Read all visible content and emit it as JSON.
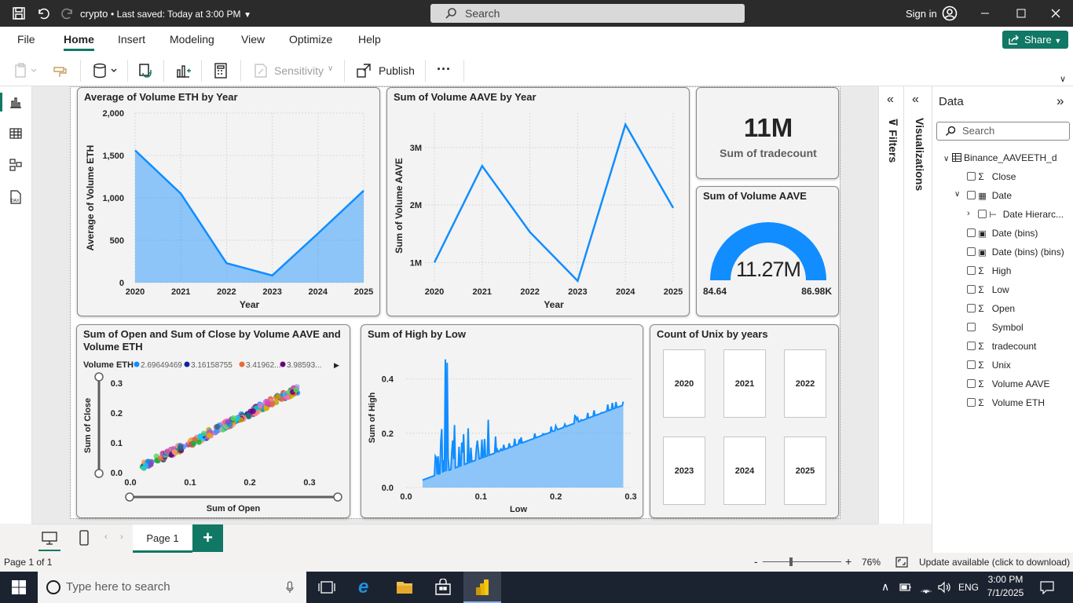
{
  "titlebar": {
    "doc": "crypto",
    "saved": "• Last saved: Today at 3:00 PM",
    "search": "Search",
    "signin": "Sign in"
  },
  "menu": [
    "File",
    "Home",
    "Insert",
    "Modeling",
    "View",
    "Optimize",
    "Help"
  ],
  "share": "Share",
  "ribbon": {
    "sensitivity": "Sensitivity",
    "publish": "Publish",
    "more": "···"
  },
  "visuals": {
    "ethTitle": "Average of Volume ETH by Year",
    "ethY": "Average of Volume ETH",
    "ethX": "Year",
    "aaveTitle": "Sum of Volume AAVE by Year",
    "aaveY": "Sum of Volume AAVE",
    "aaveX": "Year",
    "cardValue": "11M",
    "cardLabel": "Sum of tradecount",
    "gaugeTitle": "Sum of Volume AAVE",
    "gaugeValue": "11.27M",
    "gaugeMin": "84.64",
    "gaugeMax": "86.98K",
    "scatterTitle": "Sum of Open and Sum of Close by Volume AAVE and Volume ETH",
    "scatterLegendTitle": "Volume ETH",
    "scatterLegend": [
      "2.69649469",
      "3.16158755",
      "3.41962...",
      "3.98593..."
    ],
    "scatterX": "Sum of Open",
    "scatterY": "Sum of Close",
    "highTitle": "Sum of High by Low",
    "highX": "Low",
    "highY": "Sum of High",
    "slicerTitle": "Count of Unix by years",
    "years": [
      "2020",
      "2021",
      "2022",
      "2023",
      "2024",
      "2025"
    ]
  },
  "chart_data": [
    {
      "type": "area",
      "title": "Average of Volume ETH by Year",
      "x": [
        2020,
        2021,
        2022,
        2023,
        2024,
        2025
      ],
      "values": [
        1560,
        1050,
        230,
        85,
        580,
        1085
      ],
      "xlabel": "Year",
      "ylabel": "Average of Volume ETH",
      "ylim": [
        0,
        2000
      ],
      "yticks": [
        "0",
        "500",
        "1,000",
        "1,500",
        "2,000"
      ],
      "color": "#118dff"
    },
    {
      "type": "line",
      "title": "Sum of Volume AAVE by Year",
      "x": [
        2020,
        2021,
        2022,
        2023,
        2024,
        2025
      ],
      "values": [
        1000000,
        2680000,
        1530000,
        680000,
        3400000,
        1950000
      ],
      "xlabel": "Year",
      "ylabel": "Sum of Volume AAVE",
      "yticks": [
        "1M",
        "2M",
        "3M"
      ],
      "color": "#118dff"
    },
    {
      "type": "scatter",
      "title": "Sum of Open and Sum of Close by Volume AAVE and Volume ETH",
      "xlabel": "Sum of Open",
      "ylabel": "Sum of Close",
      "xlim": [
        0.0,
        0.3
      ],
      "ylim": [
        0.0,
        0.3
      ],
      "xticks": [
        "0.0",
        "0.1",
        "0.2",
        "0.3"
      ],
      "yticks": [
        "0.0",
        "0.1",
        "0.2",
        "0.3"
      ],
      "legend_title": "Volume ETH",
      "legend": [
        "2.69649469",
        "3.16158755",
        "3.41962...",
        "3.98593..."
      ],
      "legend_colors": [
        "#118dff",
        "#12239e",
        "#e66c37",
        "#6b007b"
      ]
    },
    {
      "type": "area",
      "title": "Sum of High by Low",
      "xlabel": "Low",
      "ylabel": "Sum of High",
      "xticks": [
        "0.0",
        "0.1",
        "0.2",
        "0.3"
      ],
      "yticks": [
        "0.0",
        "0.2",
        "0.4"
      ],
      "xlim": [
        0.0,
        0.3
      ],
      "ylim": [
        0.0,
        0.5
      ],
      "color": "#118dff"
    }
  ],
  "filters_label": "Filters",
  "viz_label": "Visualizations",
  "data": {
    "title": "Data",
    "search": "Search",
    "table": "Binance_AAVEETH_d",
    "fields": [
      {
        "name": "Close",
        "kind": "sigma"
      },
      {
        "name": "Date",
        "kind": "cal"
      },
      {
        "name": "Date Hierarc...",
        "kind": "hier"
      },
      {
        "name": "Date (bins)",
        "kind": "bins"
      },
      {
        "name": "Date (bins) (bins)",
        "kind": "bins"
      },
      {
        "name": "High",
        "kind": "sigma"
      },
      {
        "name": "Low",
        "kind": "sigma"
      },
      {
        "name": "Open",
        "kind": "sigma"
      },
      {
        "name": "Symbol",
        "kind": "none"
      },
      {
        "name": "tradecount",
        "kind": "sigma"
      },
      {
        "name": "Unix",
        "kind": "sigma"
      },
      {
        "name": "Volume AAVE",
        "kind": "sigma"
      },
      {
        "name": "Volume ETH",
        "kind": "sigma"
      }
    ]
  },
  "pages": {
    "tab": "Page 1"
  },
  "status": {
    "page": "Page 1 of 1",
    "zoom": "76%",
    "update": "Update available (click to download)"
  },
  "taskbar": {
    "search": "Type here to search",
    "lang": "ENG",
    "time": "3:00 PM",
    "date": "7/1/2025"
  }
}
